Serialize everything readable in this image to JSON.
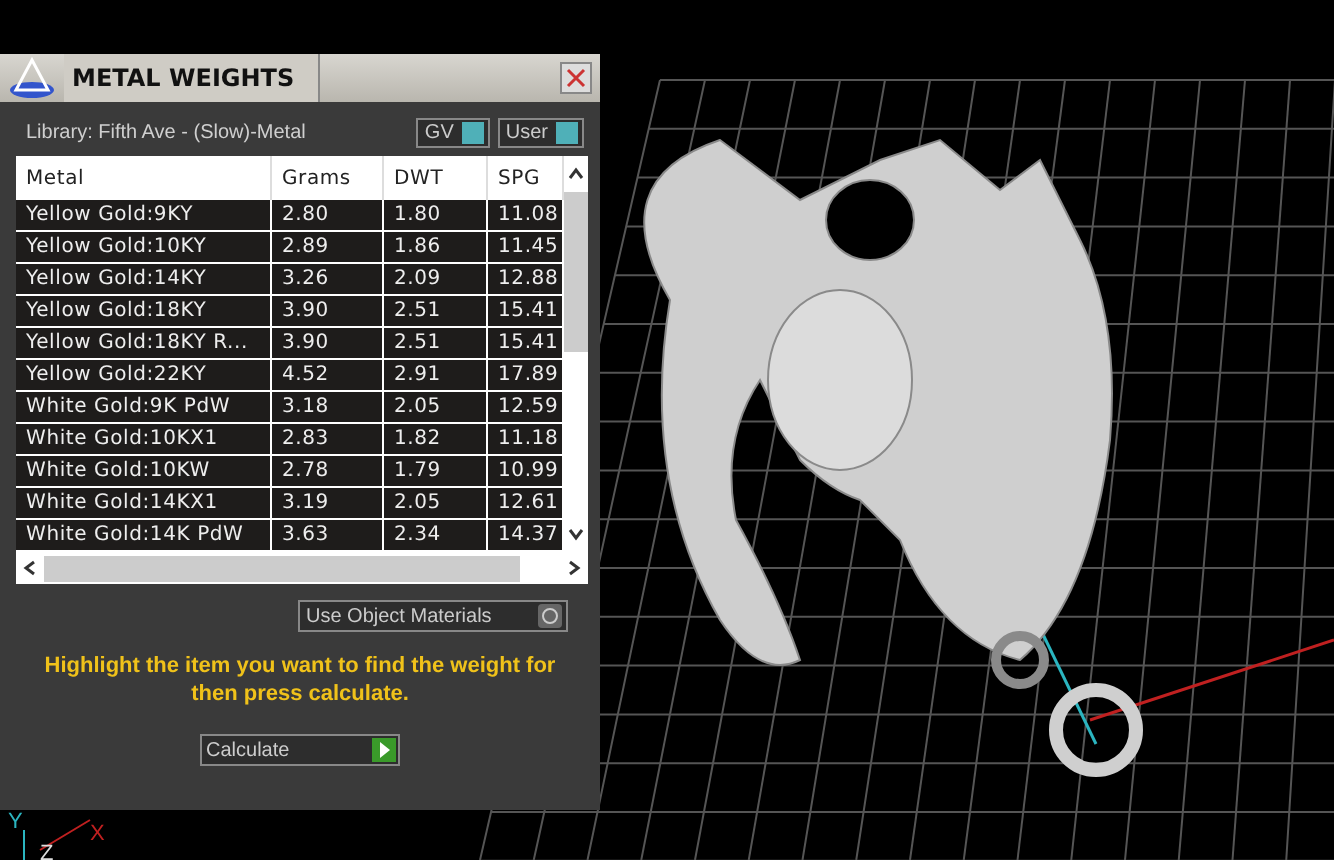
{
  "window": {
    "title": "METAL WEIGHTS"
  },
  "library": {
    "label": "Library: Fifth Ave - (Slow)-Metal",
    "toggles": [
      {
        "label": "GV",
        "on": true
      },
      {
        "label": "User",
        "on": true
      }
    ]
  },
  "table": {
    "columns": [
      "Metal",
      "Grams",
      "DWT",
      "SPG"
    ],
    "rows": [
      [
        "Yellow Gold:9KY",
        "2.80",
        "1.80",
        "11.08"
      ],
      [
        "Yellow Gold:10KY",
        "2.89",
        "1.86",
        "11.45"
      ],
      [
        "Yellow Gold:14KY",
        "3.26",
        "2.09",
        "12.88"
      ],
      [
        "Yellow Gold:18KY",
        "3.90",
        "2.51",
        "15.41"
      ],
      [
        "Yellow Gold:18KY R...",
        "3.90",
        "2.51",
        "15.41"
      ],
      [
        "Yellow Gold:22KY",
        "4.52",
        "2.91",
        "17.89"
      ],
      [
        "White Gold:9K PdW",
        "3.18",
        "2.05",
        "12.59"
      ],
      [
        "White Gold:10KX1",
        "2.83",
        "1.82",
        "11.18"
      ],
      [
        "White Gold:10KW",
        "2.78",
        "1.79",
        "10.99"
      ],
      [
        "White Gold:14KX1",
        "3.19",
        "2.05",
        "12.61"
      ],
      [
        "White Gold:14K PdW",
        "3.63",
        "2.34",
        "14.37"
      ]
    ]
  },
  "use_object_materials": {
    "label": "Use Object Materials",
    "on": false
  },
  "message": "Highlight the item you want to find the weight for then press calculate.",
  "calculate_button": "Calculate",
  "viewport": {
    "axis_labels": [
      "Y",
      "Z",
      "X"
    ]
  }
}
